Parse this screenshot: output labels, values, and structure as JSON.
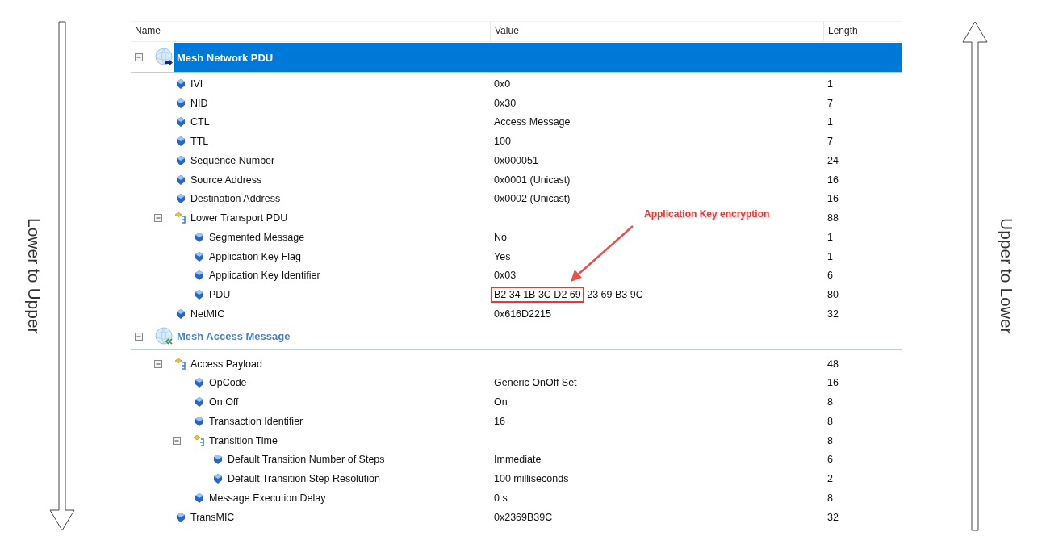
{
  "side_labels": {
    "left": "Lower to Upper",
    "right": "Upper to Lower"
  },
  "columns": [
    {
      "label": "Name"
    },
    {
      "label": "Value"
    },
    {
      "label": "Length"
    }
  ],
  "tree": [
    {
      "kind": "section",
      "name": "Mesh Network PDU",
      "selected": true,
      "expanded": true,
      "children": [
        {
          "kind": "field",
          "name": "IVI",
          "value": "0x0",
          "length": "1"
        },
        {
          "kind": "field",
          "name": "NID",
          "value": "0x30",
          "length": "7"
        },
        {
          "kind": "field",
          "name": "CTL",
          "value": "Access Message",
          "length": "1"
        },
        {
          "kind": "field",
          "name": "TTL",
          "value": "100",
          "length": "7"
        },
        {
          "kind": "field",
          "name": "Sequence Number",
          "value": "0x000051",
          "length": "24"
        },
        {
          "kind": "field",
          "name": "Source Address",
          "value": "0x0001 (Unicast)",
          "length": "16"
        },
        {
          "kind": "field",
          "name": "Destination Address",
          "value": "0x0002 (Unicast)",
          "length": "16"
        },
        {
          "kind": "group",
          "name": "Lower Transport PDU",
          "expanded": true,
          "length": "88",
          "children": [
            {
              "kind": "field",
              "name": "Segmented Message",
              "value": "No",
              "length": "1"
            },
            {
              "kind": "field",
              "name": "Application Key Flag",
              "value": "Yes",
              "length": "1"
            },
            {
              "kind": "field",
              "name": "Application Key Identifier",
              "value": "0x03",
              "length": "6"
            },
            {
              "kind": "field",
              "name": "PDU",
              "value_parts": [
                {
                  "text": "B2 34 1B 3C D2 69",
                  "boxed": true
                },
                {
                  "text": "23 69 B3 9C",
                  "boxed": false
                }
              ],
              "length": "80"
            }
          ]
        },
        {
          "kind": "field",
          "name": "NetMIC",
          "value": "0x616D2215",
          "length": "32"
        }
      ]
    },
    {
      "kind": "section",
      "name": "Mesh Access Message",
      "selected": false,
      "expanded": true,
      "children": [
        {
          "kind": "group",
          "name": "Access Payload",
          "expanded": true,
          "length": "48",
          "children": [
            {
              "kind": "field",
              "name": "OpCode",
              "value": "Generic OnOff Set",
              "length": "16"
            },
            {
              "kind": "field",
              "name": "On Off",
              "value": "On",
              "length": "8"
            },
            {
              "kind": "field",
              "name": "Transaction Identifier",
              "value": "16",
              "length": "8"
            },
            {
              "kind": "group",
              "name": "Transition Time",
              "expanded": true,
              "length": "8",
              "children": [
                {
                  "kind": "field",
                  "name": "Default Transition Number of Steps",
                  "value": "Immediate",
                  "length": "6"
                },
                {
                  "kind": "field",
                  "name": "Default Transition Step Resolution",
                  "value": "100 milliseconds",
                  "length": "2"
                }
              ]
            },
            {
              "kind": "field",
              "name": "Message Execution Delay",
              "value": "0 s",
              "length": "8"
            }
          ]
        },
        {
          "kind": "field",
          "name": "TransMIC",
          "value": "0x2369B39C",
          "length": "32"
        }
      ]
    }
  ],
  "callout": {
    "text": "Application Key encryption"
  }
}
